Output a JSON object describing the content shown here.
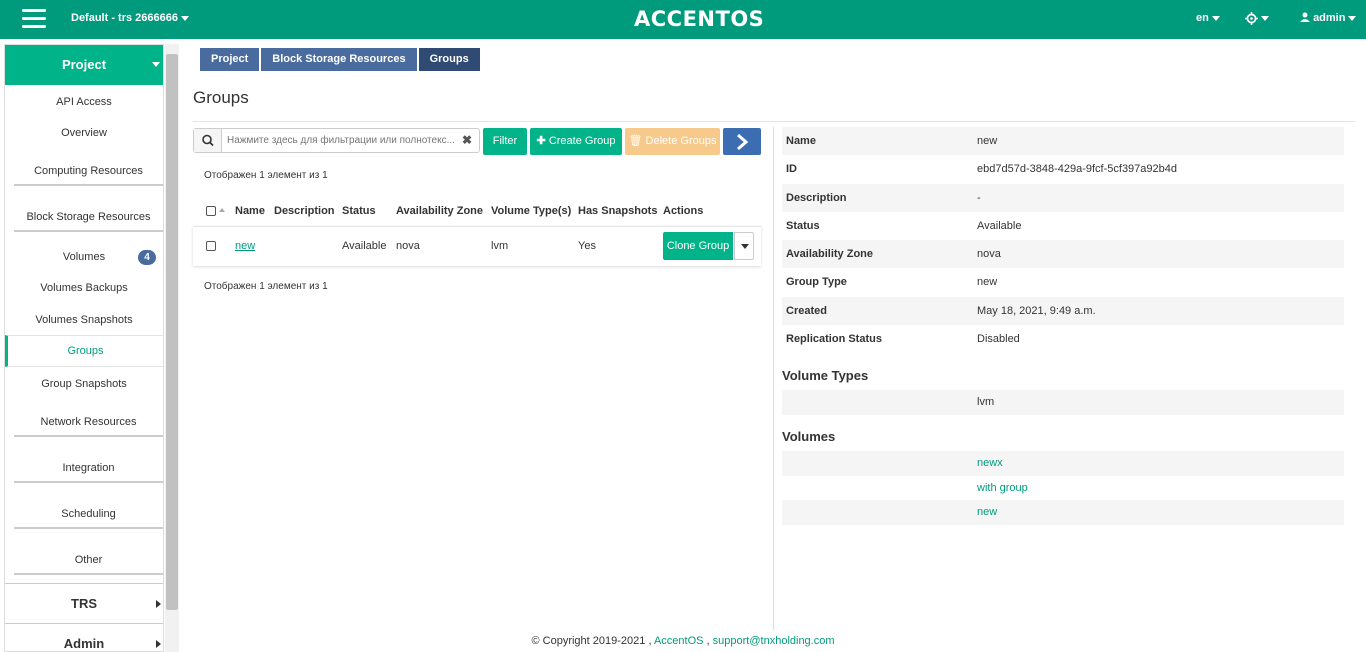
{
  "topbar": {
    "project": "Default - trs 2666666",
    "logo": "ACCENTOS",
    "lang": "en",
    "user": "admin"
  },
  "sidebar": {
    "project": "Project",
    "api_access": "API Access",
    "overview": "Overview",
    "computing": "Computing Resources",
    "block_storage": "Block Storage Resources",
    "volumes": "Volumes",
    "volumes_badge": "4",
    "volumes_backups": "Volumes Backups",
    "volumes_snapshots": "Volumes Snapshots",
    "groups": "Groups",
    "group_snapshots": "Group Snapshots",
    "network": "Network Resources",
    "integration": "Integration",
    "scheduling": "Scheduling",
    "other": "Other",
    "trs": "TRS",
    "admin": "Admin"
  },
  "breadcrumb": [
    "Project",
    "Block Storage Resources",
    "Groups"
  ],
  "page_title": "Groups",
  "toolbar": {
    "search_placeholder": "Нажмите здесь для фильтрации или полнотекс...",
    "filter": "Filter",
    "create": "Create Group",
    "delete": "Delete Groups"
  },
  "table": {
    "count_text": "Отображен 1 элемент из 1",
    "headers": [
      "Name",
      "Description",
      "Status",
      "Availability Zone",
      "Volume Type(s)",
      "Has Snapshots",
      "Actions"
    ],
    "row": {
      "name": "new",
      "description": "",
      "status": "Available",
      "zone": "nova",
      "types": "lvm",
      "snapshots": "Yes",
      "action": "Clone Group"
    }
  },
  "details": [
    {
      "key": "Name",
      "value": "new"
    },
    {
      "key": "ID",
      "value": "ebd7d57d-3848-429a-9fcf-5cf397a92b4d"
    },
    {
      "key": "Description",
      "value": "-"
    },
    {
      "key": "Status",
      "value": "Available"
    },
    {
      "key": "Availability Zone",
      "value": "nova"
    },
    {
      "key": "Group Type",
      "value": "new"
    },
    {
      "key": "Created",
      "value": "May 18, 2021, 9:49 a.m."
    },
    {
      "key": "Replication Status",
      "value": "Disabled"
    }
  ],
  "volume_types_title": "Volume Types",
  "volume_types": [
    "lvm"
  ],
  "volumes_title": "Volumes",
  "volumes": [
    "newx",
    "with group",
    "new"
  ],
  "footer": {
    "copyright": "© Copyright 2019-2021 ,",
    "brand": "AccentOS",
    "sep": ",",
    "email": "support@tnxholding.com"
  }
}
